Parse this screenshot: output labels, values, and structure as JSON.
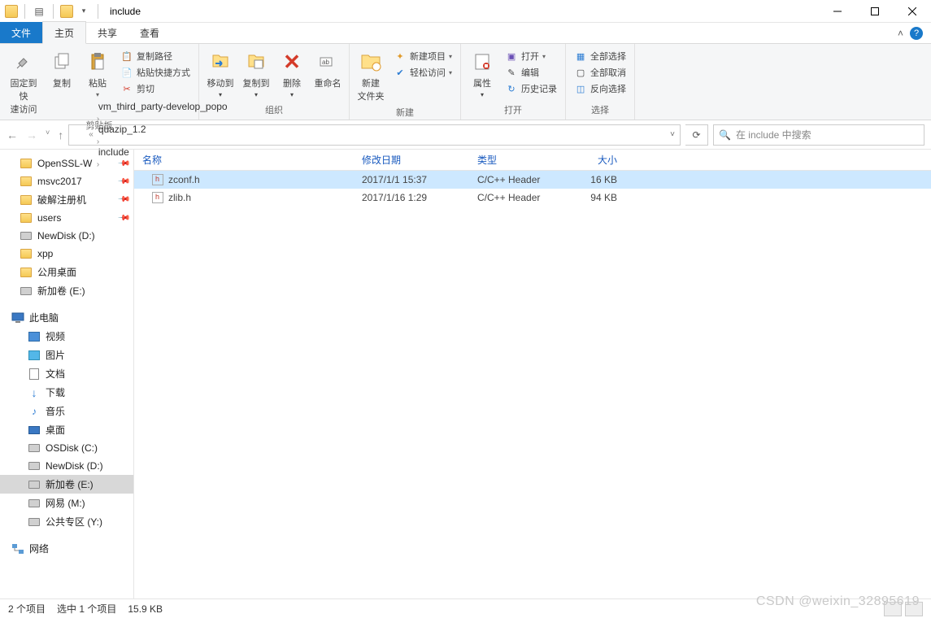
{
  "window": {
    "title": "include"
  },
  "tabs": {
    "file": "文件",
    "home": "主页",
    "share": "共享",
    "view": "查看"
  },
  "ribbon": {
    "clipboard": {
      "label": "剪贴板",
      "pin": "固定到快\n速访问",
      "copy": "复制",
      "paste": "粘贴",
      "copy_path": "复制路径",
      "paste_shortcut": "粘贴快捷方式",
      "cut": "剪切"
    },
    "organize": {
      "label": "组织",
      "move_to": "移动到",
      "copy_to": "复制到",
      "delete": "删除",
      "rename": "重命名"
    },
    "new": {
      "label": "新建",
      "new_folder": "新建\n文件夹",
      "new_item": "新建项目",
      "easy_access": "轻松访问"
    },
    "open": {
      "label": "打开",
      "properties": "属性",
      "open": "打开",
      "edit": "编辑",
      "history": "历史记录"
    },
    "select": {
      "label": "选择",
      "select_all": "全部选择",
      "select_none": "全部取消",
      "invert": "反向选择"
    }
  },
  "breadcrumb": {
    "prefix": "«",
    "items": [
      "vm_third_party-develop_popo",
      "quazip_1.2",
      "include"
    ]
  },
  "search": {
    "placeholder": "在 include 中搜索"
  },
  "tree": {
    "quick": [
      {
        "label": "OpenSSL-W",
        "icon": "folder",
        "pinned": true
      },
      {
        "label": "msvc2017",
        "icon": "folder",
        "pinned": true
      },
      {
        "label": "破解注册机",
        "icon": "folder",
        "pinned": true
      },
      {
        "label": "users",
        "icon": "folder",
        "pinned": true
      },
      {
        "label": "NewDisk (D:)",
        "icon": "drive"
      },
      {
        "label": "xpp",
        "icon": "folder"
      },
      {
        "label": "公用桌面",
        "icon": "folder"
      },
      {
        "label": "新加卷 (E:)",
        "icon": "drive"
      }
    ],
    "this_pc": "此电脑",
    "pc_children": [
      {
        "label": "视频",
        "icon": "video"
      },
      {
        "label": "图片",
        "icon": "pictures"
      },
      {
        "label": "文档",
        "icon": "docs"
      },
      {
        "label": "下载",
        "icon": "downloads"
      },
      {
        "label": "音乐",
        "icon": "music"
      },
      {
        "label": "桌面",
        "icon": "desktop"
      },
      {
        "label": "OSDisk (C:)",
        "icon": "drive"
      },
      {
        "label": "NewDisk (D:)",
        "icon": "drive"
      },
      {
        "label": "新加卷 (E:)",
        "icon": "drive",
        "selected": true
      },
      {
        "label": "网易 (M:)",
        "icon": "drive"
      },
      {
        "label": "公共专区 (Y:)",
        "icon": "drive"
      }
    ],
    "network": "网络"
  },
  "columns": {
    "name": "名称",
    "date": "修改日期",
    "type": "类型",
    "size": "大小"
  },
  "files": [
    {
      "name": "zconf.h",
      "date": "2017/1/1 15:37",
      "type": "C/C++ Header",
      "size": "16 KB",
      "selected": true
    },
    {
      "name": "zlib.h",
      "date": "2017/1/16 1:29",
      "type": "C/C++ Header",
      "size": "94 KB",
      "selected": false
    }
  ],
  "status": {
    "count": "2 个项目",
    "selected": "选中 1 个项目",
    "size": "15.9 KB"
  },
  "watermark": "CSDN @weixin_32895619"
}
